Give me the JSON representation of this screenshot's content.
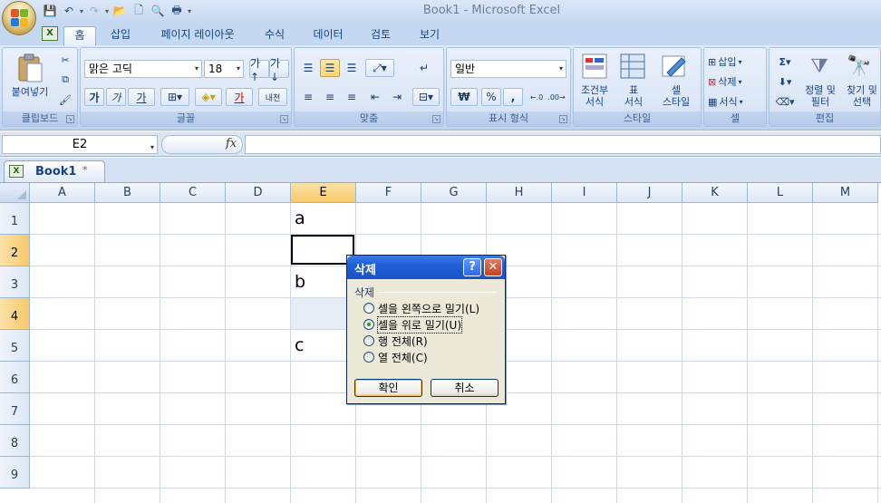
{
  "window": {
    "title": "Book1 - Microsoft Excel"
  },
  "tabs": [
    "홈",
    "삽입",
    "페이지 레이아웃",
    "수식",
    "데이터",
    "검토",
    "보기"
  ],
  "ribbon": {
    "clipboard": {
      "paste": "붙여넣기",
      "label": "클립보드"
    },
    "font": {
      "name": "맑은 고딕",
      "size": "18",
      "bold": "가",
      "italic": "가",
      "underline": "가",
      "font_color": "가",
      "phonetic": "내천",
      "label": "글꼴"
    },
    "alignment": {
      "label": "맞춤"
    },
    "number": {
      "format": "일반",
      "currency": "₩",
      "percent": "%",
      "comma": ",",
      "label": "표시 형식"
    },
    "styles": {
      "conditional": "조건부\n서식",
      "table": "표\n서식",
      "cell": "셀\n스타일",
      "label": "스타일"
    },
    "cells": {
      "insert": "삽입",
      "delete": "삭제",
      "format": "서식",
      "label": "셀"
    },
    "editing": {
      "sort": "정렬 및\n필터",
      "find": "찾기 및\n선택",
      "label": "편집"
    }
  },
  "formula_bar": {
    "name_box": "E2",
    "fx": "fx"
  },
  "workbook_tab": {
    "name": "Book1",
    "marker": "*"
  },
  "grid": {
    "columns": [
      "A",
      "B",
      "C",
      "D",
      "E",
      "F",
      "G",
      "H",
      "I",
      "J",
      "K",
      "L",
      "M"
    ],
    "rows": [
      "1",
      "2",
      "3",
      "4",
      "5",
      "6",
      "7",
      "8",
      "9"
    ],
    "cells": {
      "E1": "a",
      "E3": "b",
      "E5": "c"
    }
  },
  "dialog": {
    "title": "삭제",
    "group_label": "삭제",
    "options": [
      "셀을 왼쪽으로 밀기(L)",
      "셀을 위로 밀기(U)",
      "행 전체(R)",
      "열 전체(C)"
    ],
    "selected_index": 1,
    "ok": "확인",
    "cancel": "취소",
    "help": "?",
    "close": "✕"
  },
  "colors": {
    "accent": "#1f5fd8",
    "ribbon": "#dbe6f6",
    "selection": "#f8c96a"
  }
}
